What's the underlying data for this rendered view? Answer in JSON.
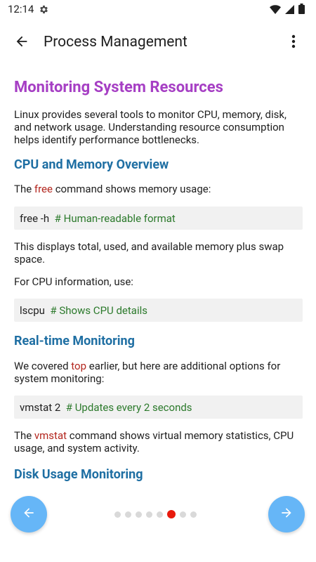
{
  "status_bar": {
    "time": "12:14"
  },
  "app_bar": {
    "title": "Process Management"
  },
  "article": {
    "heading": "Monitoring System Resources",
    "intro": "Linux provides several tools to monitor CPU, memory, disk, and network usage. Understanding resource consumption helps identify performance bottlenecks.",
    "section1": {
      "heading": "CPU and Memory Overview",
      "p1_before": "The ",
      "p1_keyword": "free",
      "p1_after": " command shows memory usage:",
      "code1_cmd": "free -h",
      "code1_comment": "# Human-readable format",
      "p2": "This displays total, used, and available memory plus swap space.",
      "p3": "For CPU information, use:",
      "code2_cmd": "lscpu",
      "code2_comment": "# Shows CPU details"
    },
    "section2": {
      "heading": "Real-time Monitoring",
      "p1_before": "We covered ",
      "p1_keyword": "top",
      "p1_after": " earlier, but here are additional options for system monitoring:",
      "code_cmd": "vmstat 2",
      "code_comment": "# Updates every 2 seconds",
      "p2_before": "The ",
      "p2_keyword": "vmstat",
      "p2_after": " command shows virtual memory statistics, CPU usage, and system activity."
    },
    "section3": {
      "heading": "Disk Usage Monitoring"
    }
  },
  "pager": {
    "total_pages": 8,
    "current_page": 6
  },
  "colors": {
    "heading_primary": "#a63fc4",
    "heading_secondary": "#1f6fa3",
    "keyword": "#b3261e",
    "code_comment": "#2c7a2c",
    "code_background": "#f1f1f1",
    "fab": "#66b6f7",
    "dot_active": "#e8190c",
    "dot_inactive": "#d9d9d9"
  },
  "icons": {
    "status": [
      "gear-icon",
      "wifi-icon",
      "signal-icon",
      "battery-icon"
    ],
    "app_bar": [
      "arrow-back-icon",
      "more-vert-icon"
    ],
    "navigation": [
      "arrow-left-icon",
      "arrow-right-icon"
    ]
  }
}
